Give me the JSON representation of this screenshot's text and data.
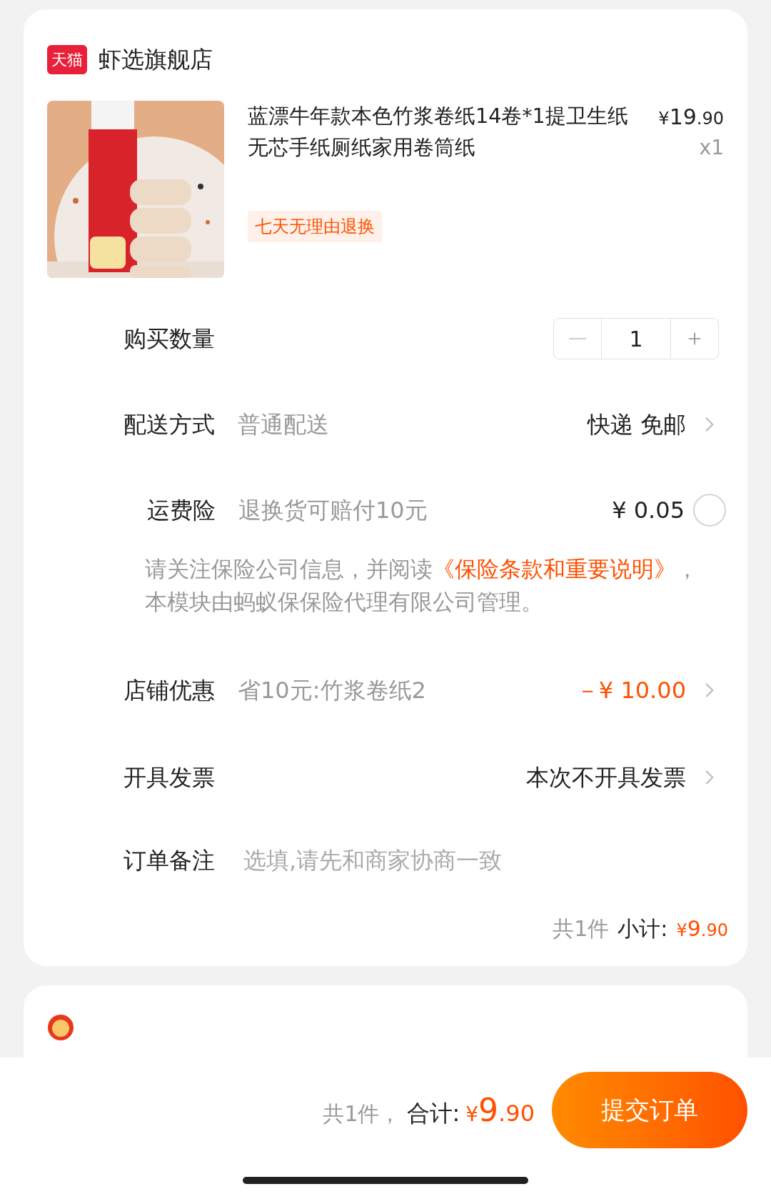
{
  "store": {
    "badge": "天猫",
    "name": "虾选旗舰店"
  },
  "product": {
    "title": "蓝漂牛年款本色竹浆卷纸14卷*1提卫生纸无芯手纸厕纸家用卷筒纸",
    "currency": "¥",
    "price_integer": "19",
    "price_decimal": ".90",
    "quantity": "x1",
    "tag": "七天无理由退换"
  },
  "rows": [
    {
      "kind": "stepper",
      "label": "购买数量",
      "value": "1"
    },
    {
      "kind": "link",
      "label": "配送方式",
      "detail": "普通配送",
      "value": "快递 免邮",
      "highlight": false
    },
    {
      "kind": "option",
      "label": "运费险",
      "detail": "退换货可赔付10元",
      "value": "¥ 0.05",
      "selected": false
    },
    {
      "kind": "notice",
      "text": "请关注保险公司信息，并阅读",
      "link": "《保险条款和重要说明》",
      "text_after": "，本模块由蚂蚁保保险代理有限公司管理。"
    },
    {
      "kind": "link",
      "label": "店铺优惠",
      "detail": "省10元:竹浆卷纸2",
      "value": "－¥ 10.00",
      "highlight": true
    },
    {
      "kind": "link",
      "label": "开具发票",
      "value": "本次不开具发票",
      "highlight": false
    },
    {
      "kind": "input",
      "label": "订单备注",
      "placeholder": "选填,请先和商家协商一致"
    }
  ],
  "subtotal": {
    "count": "共1件",
    "label": "小计:",
    "currency": "¥",
    "integer": "9",
    "decimal": ".90"
  },
  "footer": {
    "count": "共1件，",
    "label": "合计:",
    "currency": "¥",
    "integer": "9",
    "decimal": ".90",
    "submit": "提交订单"
  }
}
